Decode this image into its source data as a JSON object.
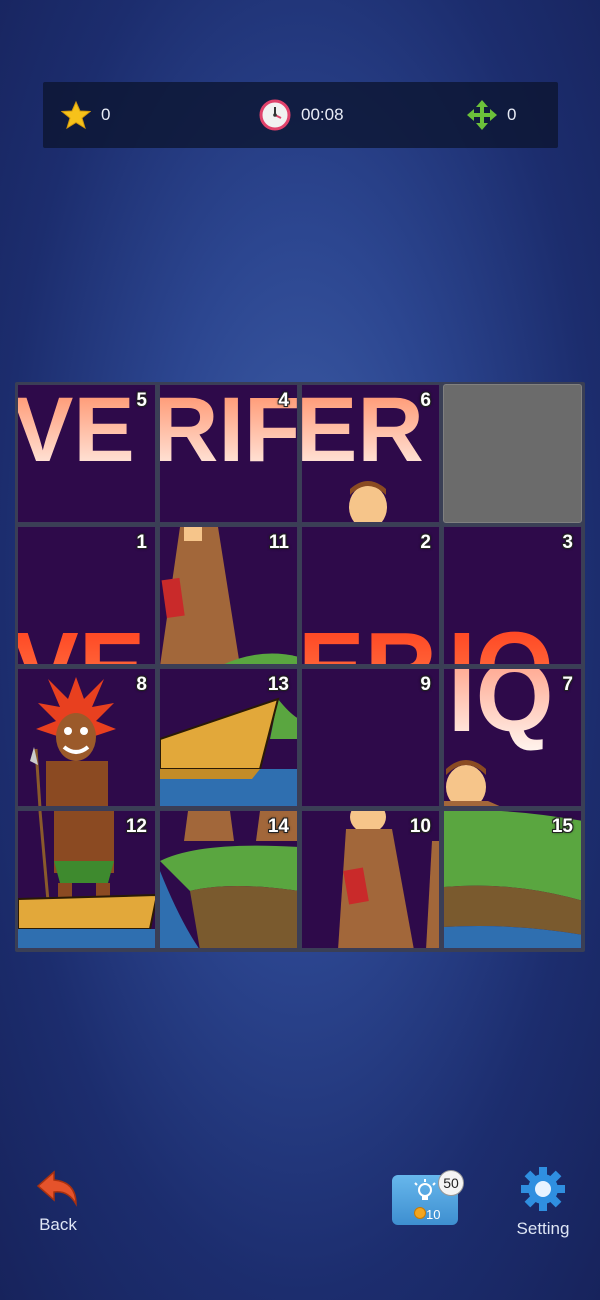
{
  "status": {
    "score": "0",
    "time": "00:08",
    "moves": "0",
    "icons": {
      "score": "star-icon",
      "time": "clock-icon",
      "moves": "move-arrows-icon"
    }
  },
  "board": {
    "grid": [
      [
        "5",
        "4",
        "6",
        ""
      ],
      [
        "1",
        "11",
        "2",
        "3"
      ],
      [
        "8",
        "13",
        "9",
        "7"
      ],
      [
        "12",
        "14",
        "10",
        "15"
      ]
    ]
  },
  "controls": {
    "back_label": "Back",
    "hint_count": "50",
    "hint_cost": "10",
    "setting_label": "Setting"
  },
  "colors": {
    "tile_bg": "#2e0a4a",
    "empty_slot": "#6b6b6b",
    "hint_button": "#4ea2de",
    "star": "#f6c21a"
  }
}
